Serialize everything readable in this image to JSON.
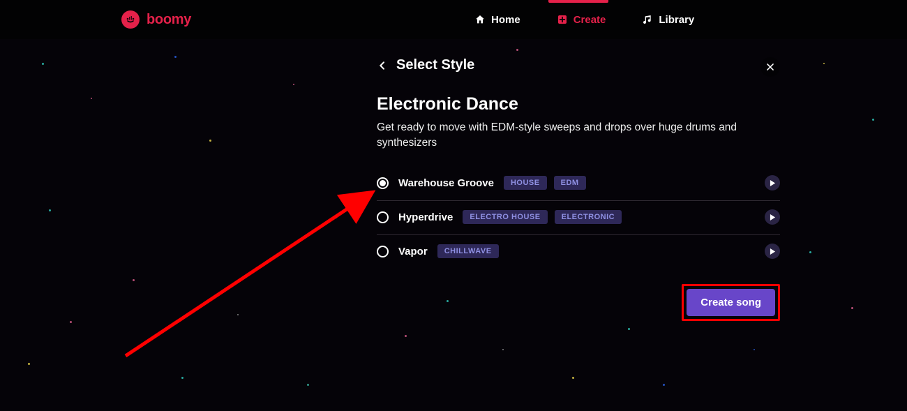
{
  "brand": {
    "name": "boomy"
  },
  "nav": {
    "home": "Home",
    "create": "Create",
    "library": "Library",
    "active": "create"
  },
  "modal": {
    "header": "Select Style",
    "style_title": "Electronic Dance",
    "style_desc": "Get ready to move with EDM-style sweeps and drops over huge drums and synthesizers",
    "options": [
      {
        "name": "Warehouse Groove",
        "tags": [
          "HOUSE",
          "EDM"
        ],
        "selected": true
      },
      {
        "name": "Hyperdrive",
        "tags": [
          "ELECTRO HOUSE",
          "ELECTRONIC"
        ],
        "selected": false
      },
      {
        "name": "Vapor",
        "tags": [
          "CHILLWAVE"
        ],
        "selected": false
      }
    ],
    "cta": "Create song"
  },
  "colors": {
    "accent": "#e5214a",
    "primary_button": "#6846c9",
    "tag_bg": "#2e2858",
    "tag_fg": "#8f90e3"
  }
}
